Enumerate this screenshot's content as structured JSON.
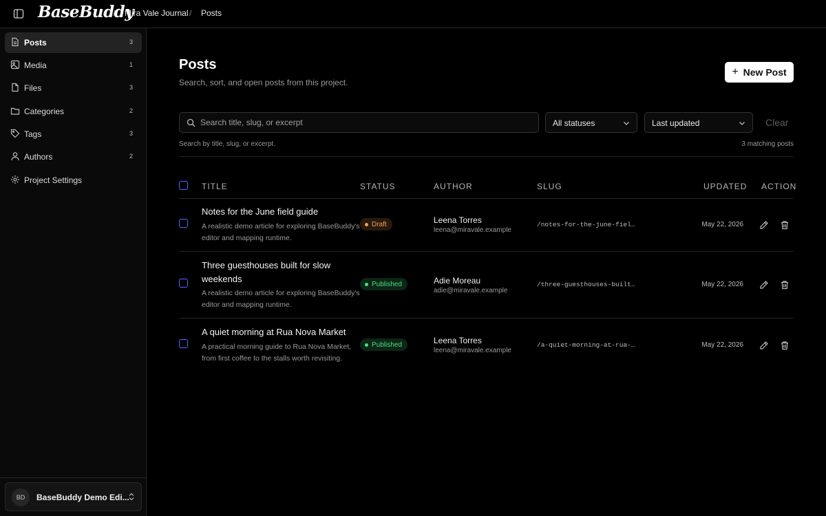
{
  "app": {
    "logo": "BaseBuddy"
  },
  "breadcrumb": [
    "Mira Vale Journal",
    "Posts"
  ],
  "sidebar": {
    "items": [
      {
        "label": "Posts",
        "count": "3",
        "icon": "document-icon",
        "active": true
      },
      {
        "label": "Media",
        "count": "1",
        "icon": "image-icon"
      },
      {
        "label": "Files",
        "count": "3",
        "icon": "file-icon"
      },
      {
        "label": "Categories",
        "count": "2",
        "icon": "folder-icon"
      },
      {
        "label": "Tags",
        "count": "3",
        "icon": "tag-icon"
      },
      {
        "label": "Authors",
        "count": "2",
        "icon": "user-icon"
      },
      {
        "label": "Project Settings",
        "count": "",
        "icon": "gear-icon"
      }
    ],
    "workspace": {
      "initials": "BD",
      "name": "BaseBuddy Demo Edi..."
    }
  },
  "page": {
    "title": "Posts",
    "subtitle": "Search, sort, and open posts from this project.",
    "new_button": "New Post"
  },
  "filters": {
    "search_placeholder": "Search title, slug, or excerpt",
    "status": "All statuses",
    "sort": "Last updated",
    "clear": "Clear",
    "hint": "Search by title, slug, or excerpt.",
    "match_count": "3 matching posts"
  },
  "table": {
    "headers": {
      "title": "TITLE",
      "status": "STATUS",
      "author": "AUTHOR",
      "slug": "SLUG",
      "updated": "UPDATED",
      "action": "ACTION"
    },
    "rows": [
      {
        "title": "Notes for the June field guide",
        "excerpt": "A realistic demo article for exploring BaseBuddy's editor and mapping runtime.",
        "status": "Draft",
        "author_name": "Leena Torres",
        "author_email": "leena@miravale.example",
        "slug": "/notes-for-the-june-field-guide",
        "updated": "May 22, 2026"
      },
      {
        "title": "Three guesthouses built for slow weekends",
        "excerpt": "A realistic demo article for exploring BaseBuddy's editor and mapping runtime.",
        "status": "Published",
        "author_name": "Adie Moreau",
        "author_email": "adie@miravale.example",
        "slug": "/three-guesthouses-built-for-slow-weekends",
        "updated": "May 22, 2026"
      },
      {
        "title": "A quiet morning at Rua Nova Market",
        "excerpt": "A practical morning guide to Rua Nova Market, from first coffee to the stalls worth revisiting.",
        "status": "Published",
        "author_name": "Leena Torres",
        "author_email": "leena@miravale.example",
        "slug": "/a-quiet-morning-at-rua-nova-market",
        "updated": "May 22, 2026"
      }
    ]
  },
  "colors": {
    "accent_checkbox": "#4f6bff",
    "draft": "#f0a05a",
    "published": "#4ade80"
  }
}
